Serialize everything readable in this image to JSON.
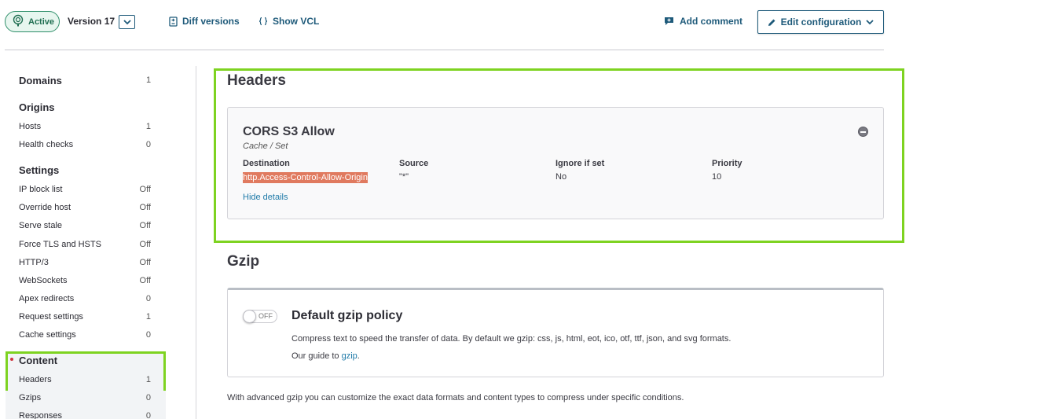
{
  "header": {
    "status_label": "Active",
    "version_label": "Version 17",
    "diff_label": "Diff versions",
    "vcl_label": "Show VCL",
    "comment_label": "Add comment",
    "edit_label": "Edit configuration"
  },
  "sidebar": {
    "domains": {
      "label": "Domains",
      "value": "1"
    },
    "origins_heading": "Origins",
    "origins_items": [
      {
        "label": "Hosts",
        "value": "1"
      },
      {
        "label": "Health checks",
        "value": "0"
      }
    ],
    "settings_heading": "Settings",
    "settings_items": [
      {
        "label": "IP block list",
        "value": "Off"
      },
      {
        "label": "Override host",
        "value": "Off"
      },
      {
        "label": "Serve stale",
        "value": "Off"
      },
      {
        "label": "Force TLS and HSTS",
        "value": "Off"
      },
      {
        "label": "HTTP/3",
        "value": "Off"
      },
      {
        "label": "WebSockets",
        "value": "Off"
      },
      {
        "label": "Apex redirects",
        "value": "0"
      },
      {
        "label": "Request settings",
        "value": "1"
      },
      {
        "label": "Cache settings",
        "value": "0"
      }
    ],
    "content_heading": "Content",
    "content_items": [
      {
        "label": "Headers",
        "value": "1"
      },
      {
        "label": "Gzips",
        "value": "0"
      },
      {
        "label": "Responses",
        "value": "0"
      }
    ]
  },
  "main": {
    "headers_title": "Headers",
    "header_card": {
      "name": "CORS S3 Allow",
      "subtitle": "Cache / Set",
      "columns": [
        {
          "label": "Destination",
          "value": "http.Access-Control-Allow-Origin"
        },
        {
          "label": "Source",
          "value": "\"*\""
        },
        {
          "label": "Ignore if set",
          "value": "No"
        },
        {
          "label": "Priority",
          "value": "10"
        }
      ],
      "hide_details": "Hide details"
    },
    "gzip_title": "Gzip",
    "gzip_card": {
      "toggle_state": "OFF",
      "title": "Default gzip policy",
      "description": "Compress text to speed the transfer of data. By default we gzip: css, js, html, eot, ico, otf, ttf, json, and svg formats.",
      "guide_prefix": "Our guide to ",
      "guide_link": "gzip",
      "guide_suffix": "."
    },
    "advanced_text": "With advanced gzip you can customize the exact data formats and content types to compress under specific conditions."
  },
  "colors": {
    "accent": "#1e5a7a",
    "highlight": "#7ed321",
    "destination_highlight": "#e07a5f",
    "active": "#2f8f6a"
  }
}
